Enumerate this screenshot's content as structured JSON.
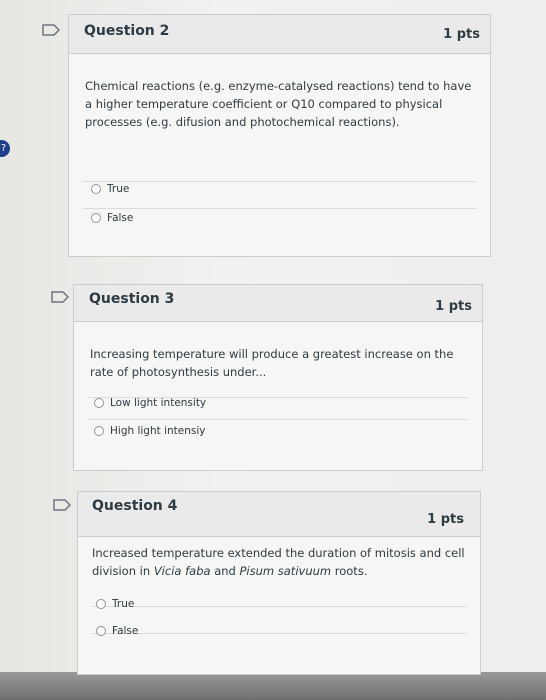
{
  "badge": {
    "text": "?"
  },
  "questions": [
    {
      "title": "Question 2",
      "points": "1 pts",
      "text": "Chemical reactions (e.g. enzyme-catalysed reactions) tend to have a higher temperature coefficient or Q10 compared to physical processes (e.g. difusion and photochemical reactions).",
      "answers": [
        "True",
        "False"
      ]
    },
    {
      "title": "Question 3",
      "points": "1 pts",
      "text": "Increasing temperature will produce a greatest increase on the rate of photosynthesis under...",
      "answers": [
        "Low light intensity",
        "High light intensiy"
      ]
    },
    {
      "title": "Question 4",
      "points": "1 pts",
      "text_parts": {
        "before": "Increased temperature extended the duration of mitosis and cell division in ",
        "species1": "Vicia faba",
        "middle": " and ",
        "species2": "Pisum sativuum",
        "after": " roots."
      },
      "answers": [
        "True",
        "False"
      ]
    }
  ],
  "icons": {
    "flag": "flag-bookmark-icon",
    "radio": "radio-button-icon"
  },
  "colors": {
    "text": "#2d3b45",
    "border": "#c7cdd1",
    "header": "#eaeaea"
  }
}
